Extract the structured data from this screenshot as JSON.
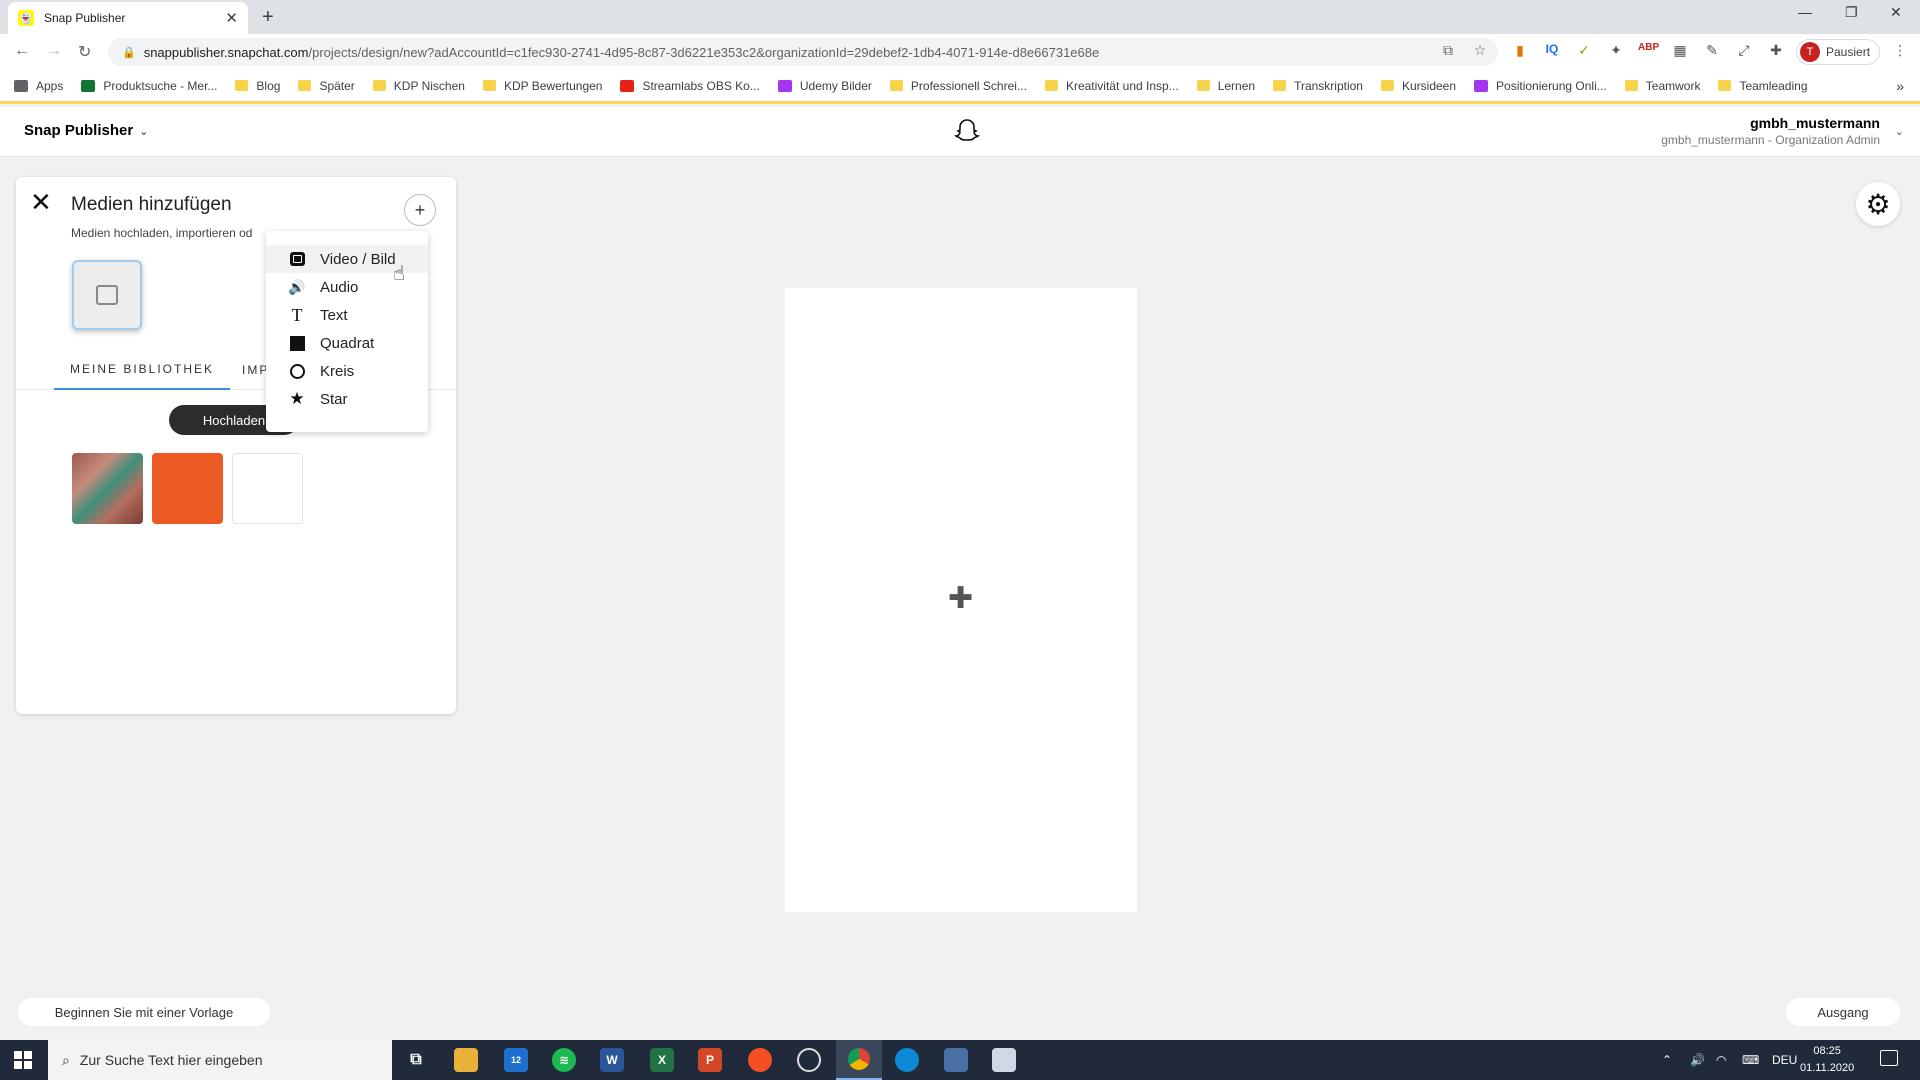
{
  "browser": {
    "tab_title": "Snap Publisher",
    "url_host": "snappublisher.snapchat.com",
    "url_path": "/projects/design/new?adAccountId=c1fec930-2741-4d95-8c87-3d6221e353c2&organizationId=29debef2-1db4-4071-914e-d8e66731e68e",
    "profile_initial": "T",
    "profile_status": "Pausiert",
    "bookmarks": [
      {
        "label": "Apps",
        "icon": "apps-grid-icon"
      },
      {
        "label": "Produktsuche - Mer...",
        "icon": "merchant-icon"
      },
      {
        "label": "Blog",
        "icon": "folder-icon"
      },
      {
        "label": "Später",
        "icon": "folder-icon"
      },
      {
        "label": "KDP Nischen",
        "icon": "folder-icon"
      },
      {
        "label": "KDP Bewertungen",
        "icon": "folder-icon"
      },
      {
        "label": "Streamlabs OBS Ko...",
        "icon": "youtube-icon"
      },
      {
        "label": "Udemy Bilder",
        "icon": "udemy-icon"
      },
      {
        "label": "Professionell Schrei...",
        "icon": "folder-icon"
      },
      {
        "label": "Kreativität und Insp...",
        "icon": "folder-icon"
      },
      {
        "label": "Lernen",
        "icon": "folder-icon"
      },
      {
        "label": "Transkription",
        "icon": "folder-icon"
      },
      {
        "label": "Kursideen",
        "icon": "folder-icon"
      },
      {
        "label": "Positionierung Onli...",
        "icon": "udemy-icon"
      },
      {
        "label": "Teamwork",
        "icon": "folder-icon"
      },
      {
        "label": "Teamleading",
        "icon": "folder-icon"
      }
    ]
  },
  "app": {
    "brand": "Snap Publisher",
    "user_name": "gmbh_mustermann",
    "user_role": "gmbh_mustermann - Organization Admin"
  },
  "panel": {
    "title": "Medien hinzufügen",
    "subtitle": "Medien hochladen, importieren od",
    "tab_library": "MEINE BIBLIOTHEK",
    "tab_import": "IMP",
    "upload_label": "Hochladen"
  },
  "menu": {
    "items": [
      {
        "label": "Video / Bild",
        "icon": "video-image-icon"
      },
      {
        "label": "Audio",
        "icon": "speaker-icon"
      },
      {
        "label": "Text",
        "icon": "text-t-icon"
      },
      {
        "label": "Quadrat",
        "icon": "square-icon"
      },
      {
        "label": "Kreis",
        "icon": "circle-icon"
      },
      {
        "label": "Star",
        "icon": "star-icon"
      }
    ]
  },
  "bottom": {
    "template_label": "Beginnen Sie mit einer Vorlage",
    "exit_label": "Ausgang"
  },
  "taskbar": {
    "search_placeholder": "Zur Suche Text hier eingeben",
    "lang": "DEU",
    "time": "08:25",
    "date": "01.11.2020",
    "mail_badge": "12"
  },
  "colors": {
    "accent_blue": "#3a8ee6",
    "bookmark_underline": "#fbd95b",
    "thumb_orange": "#ec5a24",
    "taskbar": "#202a3a"
  }
}
